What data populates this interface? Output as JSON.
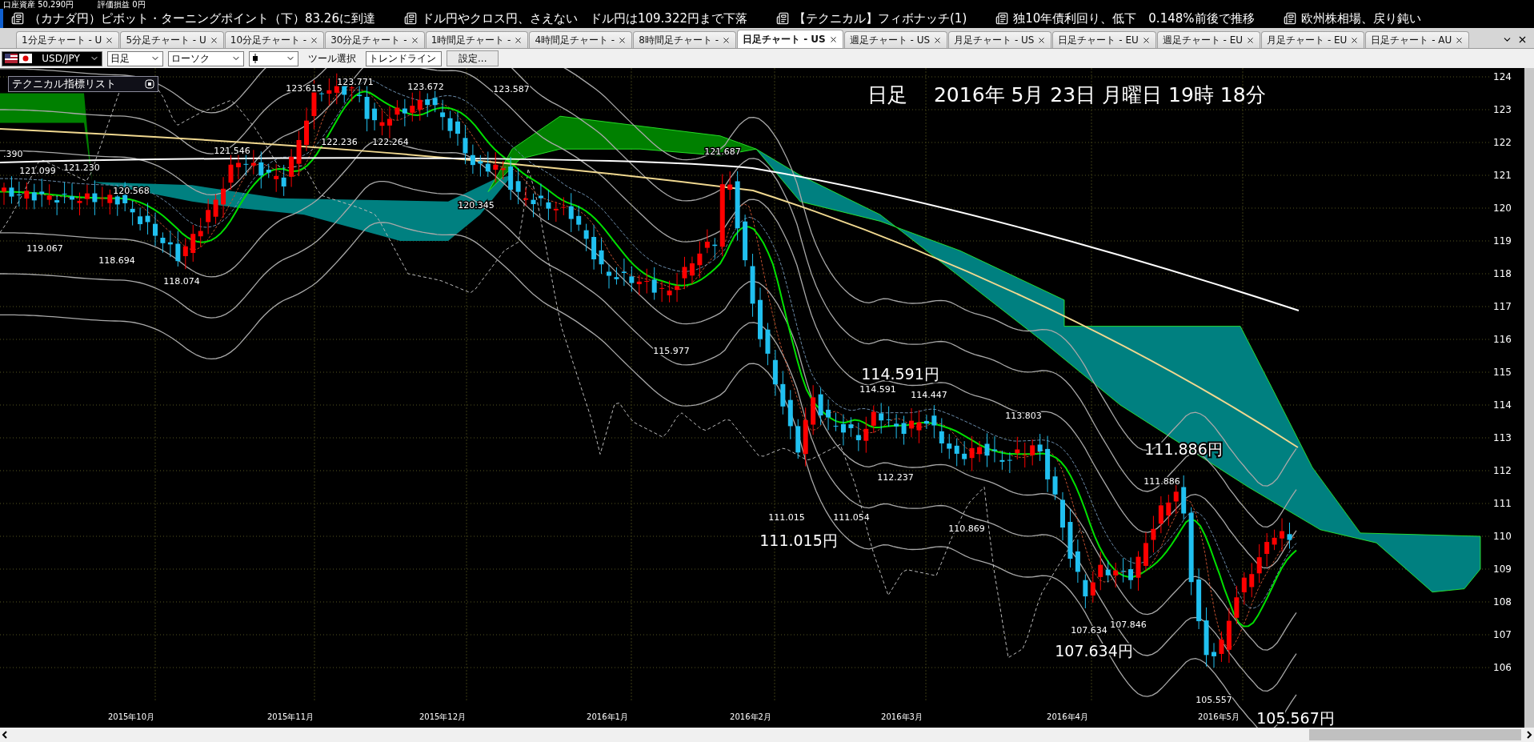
{
  "account": {
    "balance": "口座資産 50,290円",
    "pnl": "評価損益 0円"
  },
  "ticker": [
    {
      "text": "（カナダ円）ピボット・ターニングポイント（下）83.26に到達"
    },
    {
      "text": "ドル円やクロス円、さえない　ドル円は109.322円まで下落"
    },
    {
      "text": "【テクニカル】フィボナッチ(1)"
    },
    {
      "text": "独10年債利回り、低下　0.148%前後で推移"
    },
    {
      "text": "欧州株相場、戻り鈍い"
    }
  ],
  "tabs": [
    {
      "label": "1分足チャート - U",
      "selected": false
    },
    {
      "label": "5分足チャート - U",
      "selected": false
    },
    {
      "label": "10分足チャート -",
      "selected": false
    },
    {
      "label": "30分足チャート -",
      "selected": false
    },
    {
      "label": "1時間足チャート -",
      "selected": false
    },
    {
      "label": "4時間足チャート -",
      "selected": false
    },
    {
      "label": "8時間足チャート -",
      "selected": false
    },
    {
      "label": "日足チャート - US",
      "selected": true
    },
    {
      "label": "週足チャート - US",
      "selected": false
    },
    {
      "label": "月足チャート - US",
      "selected": false
    },
    {
      "label": "日足チャート - EU",
      "selected": false
    },
    {
      "label": "週足チャート - EU",
      "selected": false
    },
    {
      "label": "月足チャート - EU",
      "selected": false
    },
    {
      "label": "日足チャート - AU",
      "selected": false
    }
  ],
  "toolbar": {
    "symbol": "USD/JPY",
    "timeframe": "日足",
    "chart_type": "ローソク",
    "tool_label": "ツール選択",
    "tool": "トレンドライン",
    "settings_button": "設定..."
  },
  "chart": {
    "title": "日足　 2016年 5月 23日 月曜日 19時 18分",
    "indicator_panel": "テクニカル指標リスト",
    "price_labels": [
      ".390",
      "121.099",
      "121.230",
      "120.568",
      "119.067",
      "118.694",
      "118.074",
      "121.546",
      "123.615",
      "123.771",
      "122.236",
      "123.672",
      "122.264",
      "123.587",
      "120.345",
      "121.687",
      "115.977",
      "114.591",
      "114.447",
      "113.803",
      "112.237",
      "111.015",
      "111.054",
      "110.869",
      "107.634",
      "107.846",
      "111.886",
      "105.557"
    ],
    "callouts": [
      "114.591円",
      "111.886円",
      "111.015円",
      "107.634円",
      "105.567円"
    ],
    "y_axis": [
      "124",
      "123",
      "122",
      "121",
      "120",
      "119",
      "118",
      "117",
      "116",
      "115",
      "114",
      "113",
      "112",
      "111",
      "110",
      "109",
      "108",
      "107",
      "106"
    ],
    "x_axis": [
      "2015年10月",
      "2015年11月",
      "2015年12月",
      "2016年1月",
      "2016年2月",
      "2016年3月",
      "2016年4月",
      "2016年5月"
    ]
  }
}
